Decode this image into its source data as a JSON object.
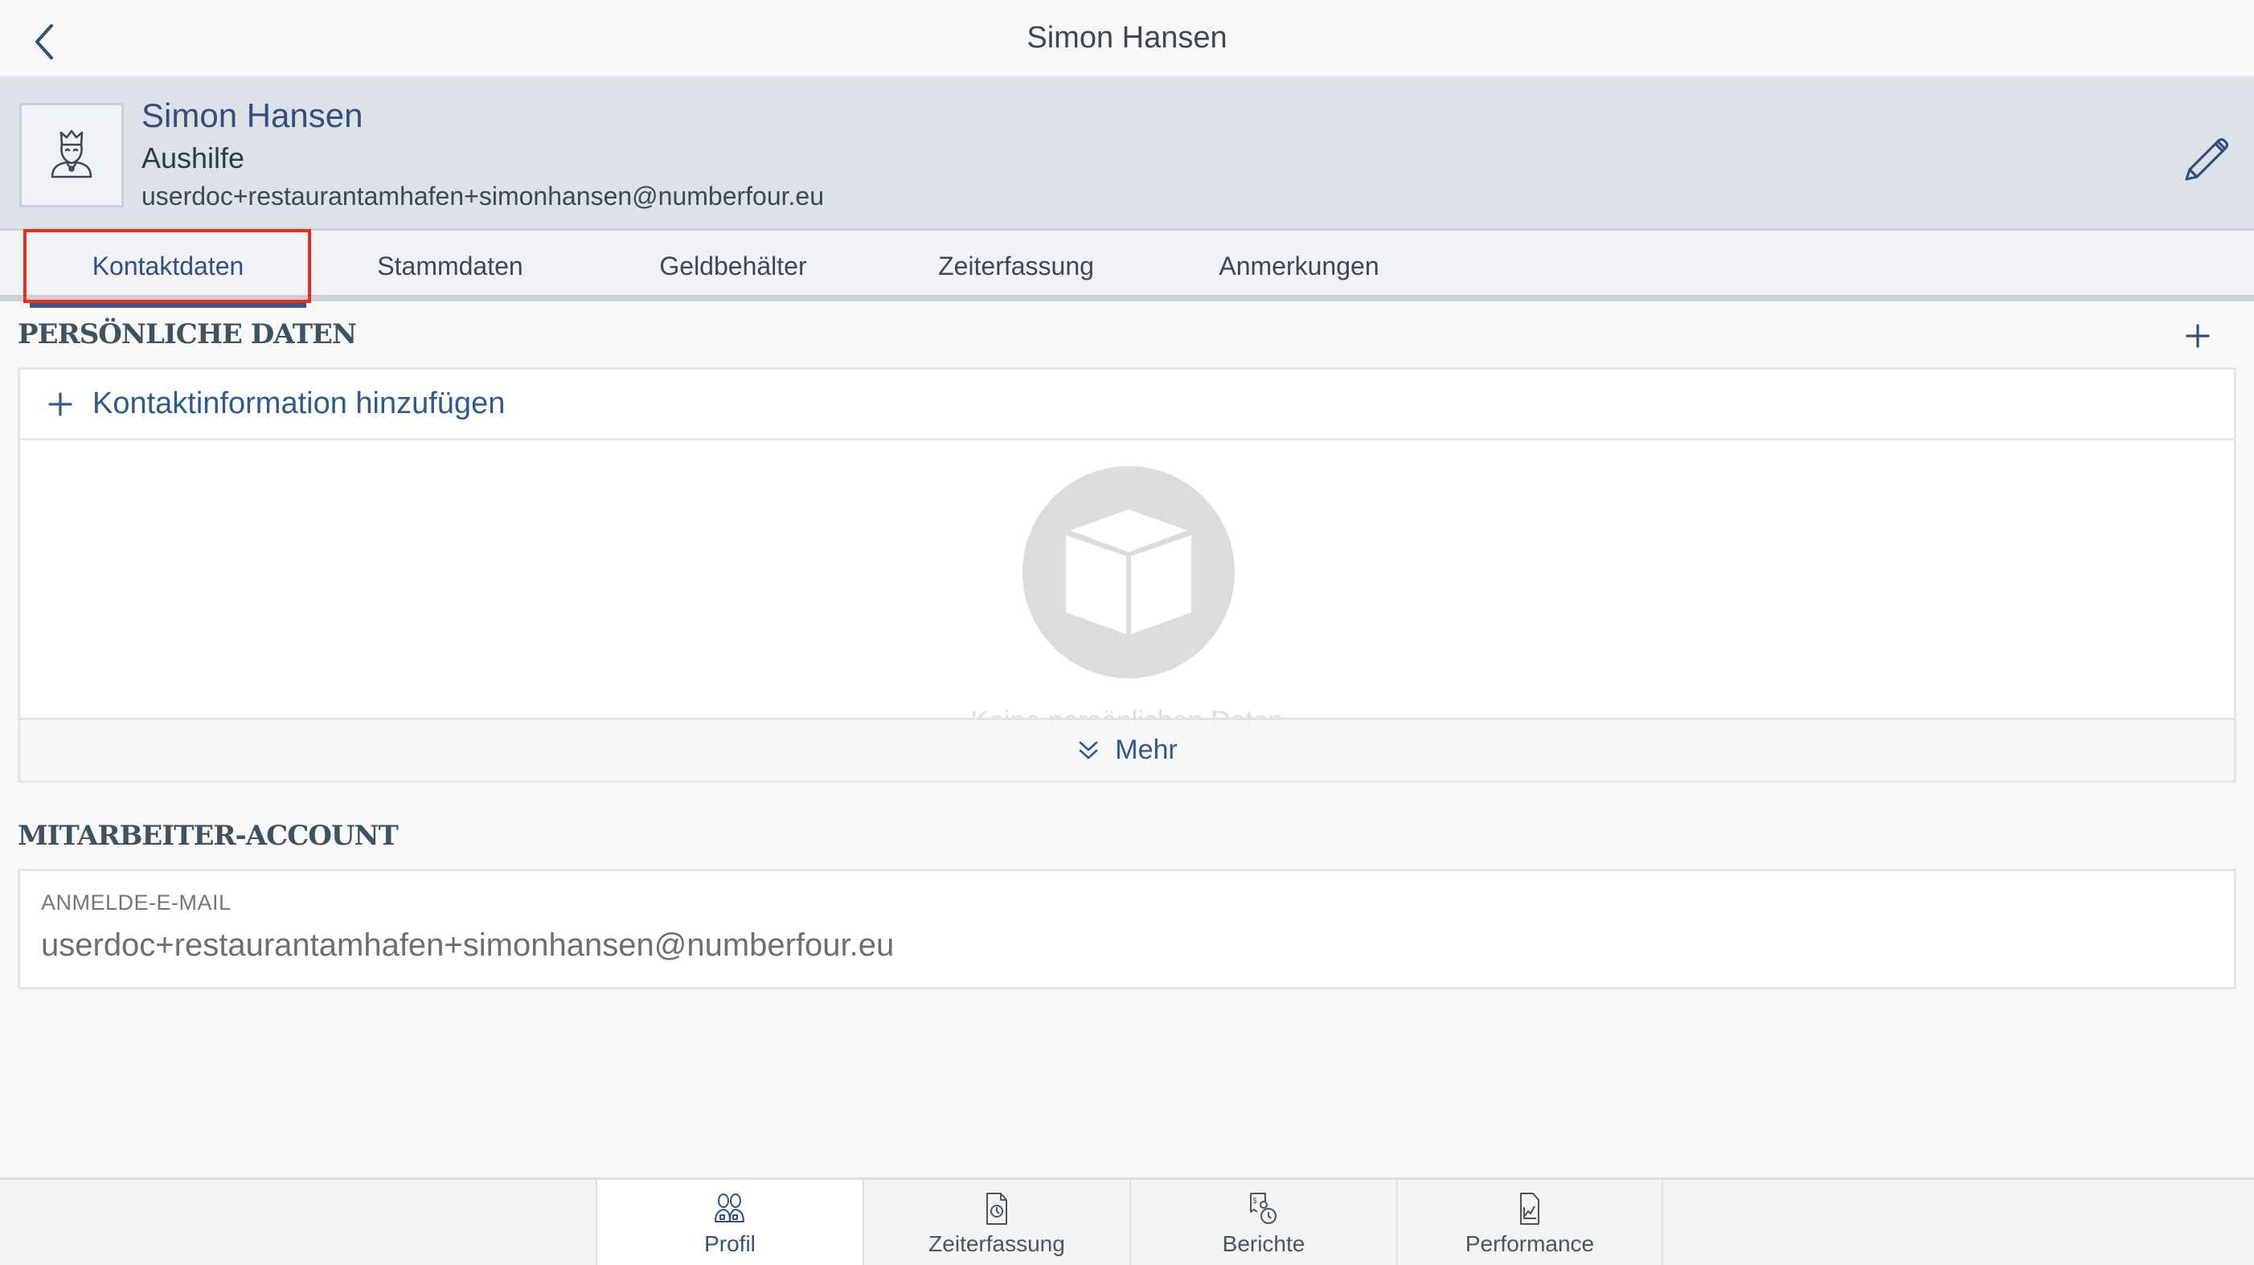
{
  "topnav": {
    "title": "Simon Hansen",
    "back_icon": "chevron-left-icon"
  },
  "profile": {
    "name": "Simon Hansen",
    "role": "Aushilfe",
    "email": "userdoc+restaurantamhafen+simonhansen@numberfour.eu",
    "avatar_icon": "person-crown-icon",
    "edit_icon": "pencil-icon"
  },
  "tabs": [
    {
      "label": "Kontaktdaten",
      "active": true,
      "highlighted": true
    },
    {
      "label": "Stammdaten",
      "active": false
    },
    {
      "label": "Geldbehälter",
      "active": false
    },
    {
      "label": "Zeiterfassung",
      "active": false
    },
    {
      "label": "Anmerkungen",
      "active": false
    }
  ],
  "personal": {
    "title": "PERSÖNLICHE DATEN",
    "add_icon": "plus-icon",
    "add_contact_label": "Kontaktinformation hinzufügen",
    "empty_icon": "box-icon",
    "empty_text": "Keine persönlichen Daten",
    "more_label": "Mehr",
    "more_icon": "double-chevron-down-icon"
  },
  "account": {
    "title": "MITARBEITER-ACCOUNT",
    "login_email_label": "ANMELDE-E-MAIL",
    "login_email_value": "userdoc+restaurantamhafen+simonhansen@numberfour.eu"
  },
  "bottom_tabs": [
    {
      "label": "Profil",
      "icon": "users-icon",
      "active": true
    },
    {
      "label": "Zeiterfassung",
      "icon": "document-clock-icon",
      "active": false
    },
    {
      "label": "Berichte",
      "icon": "receipt-clock-icon",
      "active": false
    },
    {
      "label": "Performance",
      "icon": "document-chart-icon",
      "active": false
    }
  ],
  "colors": {
    "accent": "#344f7e",
    "link": "#2e5a8c",
    "highlight_box": "#f12a16",
    "header_bg": "#dde1e8"
  }
}
